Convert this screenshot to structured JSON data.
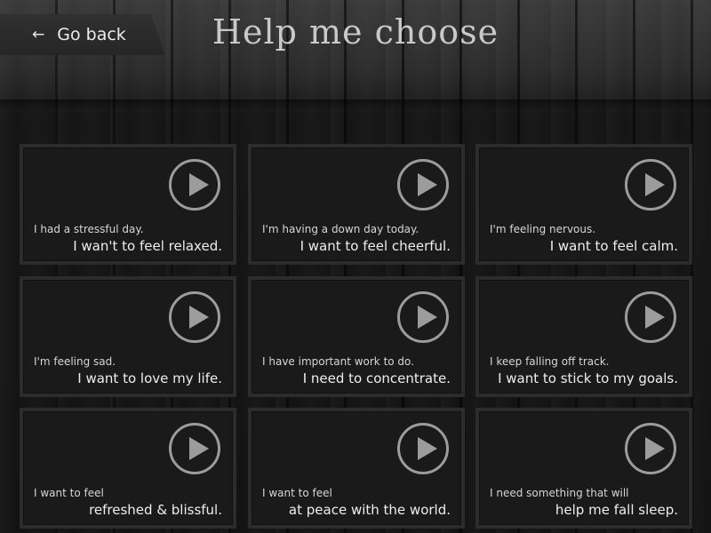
{
  "header": {
    "back_label": "Go back",
    "back_arrow": "←",
    "title": "Help me choose"
  },
  "options": [
    {
      "line1": "I had a stressful day.",
      "line2": "I wan't to feel relaxed."
    },
    {
      "line1": "I'm having a down day today.",
      "line2": "I want to feel cheerful."
    },
    {
      "line1": "I'm feeling nervous.",
      "line2": "I want to feel calm."
    },
    {
      "line1": "I'm feeling sad.",
      "line2": "I want to love my life."
    },
    {
      "line1": "I have important work to do.",
      "line2": "I need to concentrate."
    },
    {
      "line1": "I keep falling off track.",
      "line2": "I want to stick to my goals."
    },
    {
      "line1": "I want to feel",
      "line2": "refreshed & blissful."
    },
    {
      "line1": "I want to feel",
      "line2": "at peace with the world."
    },
    {
      "line1": "I need something that will",
      "line2": "help me fall sleep."
    }
  ],
  "icons": {
    "play": "play-icon"
  },
  "colors": {
    "background": "#141414",
    "card": "#1a1a1a",
    "icon": "#9c9c9c",
    "text": "#eeeeee"
  }
}
